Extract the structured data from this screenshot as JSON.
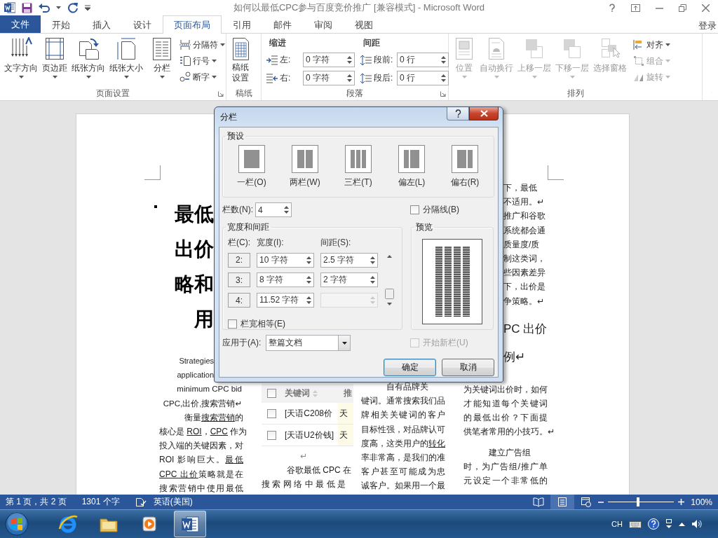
{
  "title_bar": {
    "title": "如何以最低CPC参与百度竞价推广 [兼容模式] - Microsoft Word"
  },
  "ribbon_tabs": [
    {
      "label": "文件",
      "kind": "file",
      "selected": false
    },
    {
      "label": "开始",
      "kind": "tab",
      "selected": false
    },
    {
      "label": "插入",
      "kind": "tab",
      "selected": false
    },
    {
      "label": "设计",
      "kind": "tab",
      "selected": false
    },
    {
      "label": "页面布局",
      "kind": "tab",
      "selected": true
    },
    {
      "label": "引用",
      "kind": "tab",
      "selected": false
    },
    {
      "label": "邮件",
      "kind": "tab",
      "selected": false
    },
    {
      "label": "审阅",
      "kind": "tab",
      "selected": false
    },
    {
      "label": "视图",
      "kind": "tab",
      "selected": false
    }
  ],
  "account": "登录",
  "page_setup": {
    "label": "页面设置",
    "large_buttons": [
      {
        "label": "文字方向",
        "dropdown": true
      },
      {
        "label": "页边距",
        "dropdown": true
      },
      {
        "label": "纸张方向",
        "dropdown": true
      },
      {
        "label": "纸张大小",
        "dropdown": true
      },
      {
        "label": "分栏",
        "dropdown": true
      }
    ],
    "small_buttons": [
      {
        "label": "分隔符"
      },
      {
        "label": "行号"
      },
      {
        "label": "断字"
      }
    ]
  },
  "manuscript": {
    "label": "稿纸",
    "button": "稿纸设置"
  },
  "paragraph": {
    "label": "段落",
    "indent_title": "缩进",
    "spacing_title": "间距",
    "indent_fields": [
      {
        "label": "左:",
        "value": "0 字符"
      },
      {
        "label": "右:",
        "value": "0 字符"
      }
    ],
    "spacing_fields": [
      {
        "label": "段前:",
        "value": "0 行"
      },
      {
        "label": "段后:",
        "value": "0 行"
      }
    ]
  },
  "arrange": {
    "label": "排列",
    "large_buttons": [
      {
        "label": "位置",
        "dropdown": true,
        "disabled": true
      },
      {
        "label": "自动换行",
        "dropdown": true,
        "disabled": true
      },
      {
        "label": "上移一层",
        "dropdown": true,
        "disabled": true
      },
      {
        "label": "下移一层",
        "dropdown": true,
        "disabled": true
      },
      {
        "label": "选择窗格",
        "dropdown": false,
        "disabled": true
      }
    ],
    "small_buttons": [
      {
        "label": "对齐",
        "disabled": false
      },
      {
        "label": "组合",
        "disabled": true
      },
      {
        "label": "旋转",
        "disabled": true
      }
    ]
  },
  "document": {
    "columns": [
      {
        "lines": [
          {
            "kind": "title",
            "text": "最低"
          },
          {
            "kind": "title",
            "text": "出价"
          },
          {
            "kind": "title",
            "text": "略和"
          },
          {
            "kind": "title",
            "text": "用"
          },
          {
            "kind": "caption",
            "text": "Strategies"
          },
          {
            "kind": "caption",
            "text": "application"
          },
          {
            "kind": "keywords",
            "text": "minimum CPC bid"
          },
          {
            "kind": "keywords",
            "text": "CPC,出价,搜索营销↵"
          },
          {
            "kind": "indent",
            "parts": [
              {
                "text": "衡量"
              },
              {
                "text": "搜索营销",
                "link": true
              },
              {
                "text": "的"
              }
            ]
          },
          {
            "kind": "text",
            "parts": [
              {
                "text": "核心是 "
              },
              {
                "text": "ROI",
                "link": true
              },
              {
                "text": "，"
              },
              {
                "text": "CPC",
                "link": true
              },
              {
                "text": " 作为"
              }
            ]
          },
          {
            "kind": "text",
            "text": "投入端的关键因素，对"
          },
          {
            "kind": "text",
            "parts": [
              {
                "text": "ROI 影响巨大。"
              },
              {
                "text": "最低",
                "link": true
              }
            ]
          },
          {
            "kind": "text",
            "parts": [
              {
                "text": "CPC 出价",
                "link": true
              },
              {
                "text": "策略就是在"
              }
            ]
          },
          {
            "kind": "text",
            "text": "搜索营销中使用最低"
          }
        ]
      },
      {
        "table": {
          "header": {
            "checked": false,
            "cells": [
              "关键词",
              "推"
            ]
          },
          "rows": [
            {
              "checked": false,
              "cells": [
                "[天语C208价",
                "天"
              ]
            },
            {
              "checked": false,
              "cells": [
                "[天语U2价钱]",
                "天"
              ]
            }
          ]
        },
        "lines": [
          {
            "kind": "center",
            "text": "↵"
          },
          {
            "kind": "indent",
            "text": "谷歌最低 CPC 在"
          },
          {
            "kind": "text",
            "text": "搜索网络中最低是"
          }
        ]
      },
      {
        "lines": [
          {
            "kind": "indent",
            "text": "自有品牌关"
          },
          {
            "kind": "text",
            "text": "键词。通常搜索我们品"
          },
          {
            "kind": "text",
            "text": "牌相关关键词的客户"
          },
          {
            "kind": "text",
            "text": "目标性强，对品牌认可"
          },
          {
            "kind": "text",
            "parts": [
              {
                "text": "度高，这类用户的"
              },
              {
                "text": "转化",
                "link": true
              }
            ]
          },
          {
            "kind": "text",
            "text": "率非常高，是我们的准"
          },
          {
            "kind": "text",
            "text": "客户甚至可能成为忠"
          },
          {
            "kind": "text",
            "text": "诚客户。如果用一个最"
          }
        ]
      },
      {
        "lines": [
          {
            "kind": "fragment",
            "text": "下，最低"
          },
          {
            "kind": "fragment",
            "text": "不适用。↵"
          },
          {
            "kind": "fragment",
            "text": "推广和谷歌"
          },
          {
            "kind": "fragment",
            "text": "系统都会通"
          },
          {
            "kind": "fragment",
            "text": "质量度/质"
          },
          {
            "kind": "fragment",
            "text": "制这类词，"
          },
          {
            "kind": "fragment",
            "text": "些因素差异"
          },
          {
            "kind": "fragment",
            "text": "下，出价是"
          },
          {
            "kind": "fragment",
            "text": "争策略。↵"
          },
          {
            "kind": "heading_fragment",
            "text": "PC 出价"
          },
          {
            "kind": "heading_fragment",
            "text": "例↵"
          },
          {
            "kind": "text",
            "text": "为关键词出价时，如何"
          },
          {
            "kind": "text",
            "text": "才能知道每个关键词"
          },
          {
            "kind": "text",
            "text": "的最低出价？下面提"
          },
          {
            "kind": "text",
            "text": "供笔者常用的小技巧。↵"
          },
          {
            "kind": "para_indent",
            "text": "建立广告组"
          },
          {
            "kind": "text",
            "text": "时，为广告组/推广单"
          },
          {
            "kind": "text",
            "text": "元设定一个非常低的"
          }
        ]
      }
    ]
  },
  "dialog": {
    "title": "分栏",
    "presets_label": "预设",
    "presets": [
      {
        "label": "一栏(O)"
      },
      {
        "label": "两栏(W)"
      },
      {
        "label": "三栏(T)"
      },
      {
        "label": "偏左(L)"
      },
      {
        "label": "偏右(R)"
      }
    ],
    "count_label": "栏数(N):",
    "count": "4",
    "divider": {
      "label": "分隔线(B)",
      "checked": false
    },
    "width_group": "宽度和间距",
    "column_header": "栏(C):",
    "width_header": "宽度(I):",
    "spacing_header": "间距(S):",
    "rows": [
      {
        "number": "2:",
        "width": "10 字符",
        "spacing": {
          "value": "2.5 字符",
          "disabled": false
        }
      },
      {
        "number": "3:",
        "width": "8 字符",
        "spacing": {
          "value": "2 字符",
          "disabled": false
        }
      },
      {
        "number": "4:",
        "width": "11.52 字符",
        "spacing": {
          "disabled": true
        }
      }
    ],
    "equal_width": {
      "label": "栏宽相等(E)",
      "checked": false
    },
    "preview_label": "预览",
    "apply_label": "应用于(A):",
    "apply_value": "整篇文档",
    "new_column": {
      "label": "开始新栏(U)",
      "checked": false,
      "disabled": true
    },
    "buttons": [
      {
        "label": "确定",
        "default": true
      },
      {
        "label": "取消",
        "default": false
      }
    ]
  },
  "status_bar": {
    "page": "第 1 页，共 2 页",
    "words": "1301 个字",
    "language": "英语(美国)",
    "views": [
      {
        "selected": false
      },
      {
        "selected": true
      },
      {
        "selected": false
      }
    ],
    "zoom": {
      "level": 0.46,
      "reading": "100%"
    }
  },
  "taskbar": {
    "apps": [
      {
        "selected": false
      },
      {
        "selected": false
      },
      {
        "selected": false
      },
      {
        "selected": true
      }
    ],
    "input_language": "CH"
  }
}
